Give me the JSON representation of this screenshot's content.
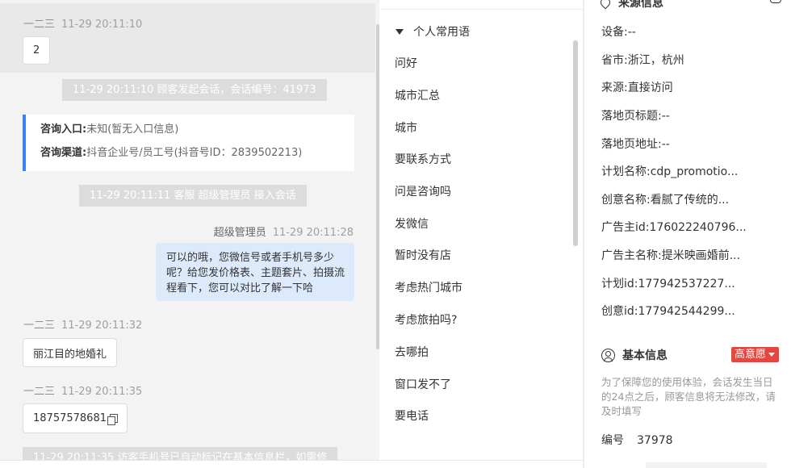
{
  "chat": {
    "messages": [
      {
        "sender": "一二三",
        "time": "11-29 20:11:10",
        "text": "2"
      },
      {
        "sender": "一二三",
        "time": "11-29 20:11:32",
        "text": "丽江目的地婚礼"
      },
      {
        "sender": "一二三",
        "time": "11-29 20:11:35",
        "text": "18757578681"
      }
    ],
    "system_start": "11-29 20:11:10 顾客发起会话，会话编号：41973",
    "consult": {
      "entry_label": "咨询入口:",
      "entry_value": "未知(暂无入口信息)",
      "channel_label": "咨询渠道:",
      "channel_value": "抖音企业号/员工号(抖音号ID：2839502213)"
    },
    "system_agent": "11-29 20:11:11 客服 超级管理员 接入会话",
    "agent_reply": {
      "sender": "超级管理员",
      "time": "11-29 20:11:28",
      "text": "可以的哦，您微信号或者手机号多少呢？给您发价格表、主题套片、拍摄流程看下，您可以对比了解一下哈"
    },
    "system_partial": "11-29 20:11:35 访客手机号已自动标记在基本信息栏，如需修"
  },
  "phrases": {
    "header": "个人常用语",
    "items": [
      "问好",
      "城市汇总",
      "城市",
      "要联系方式",
      "问是咨询吗",
      "发微信",
      "暂时没有店",
      "考虑热门城市",
      "考虑旅拍吗?",
      "去哪拍",
      "窗口发不了",
      "要电话"
    ]
  },
  "source": {
    "title": "来源信息",
    "fields": [
      {
        "label": "设备:",
        "value": "--"
      },
      {
        "label": "省市:",
        "value": "浙江，杭州"
      },
      {
        "label": "来源:",
        "value": "直接访问"
      },
      {
        "label": "落地页标题:",
        "value": "--"
      },
      {
        "label": "落地页地址:",
        "value": "--"
      },
      {
        "label": "计划名称:",
        "value": "cdp_promotio..."
      },
      {
        "label": "创意名称:",
        "value": "看腻了传统的..."
      },
      {
        "label": "广告主id:",
        "value": "176022240796..."
      },
      {
        "label": "广告主名称:",
        "value": "提米映画婚前..."
      },
      {
        "label": "计划id:",
        "value": "177942537227..."
      },
      {
        "label": "创意id:",
        "value": "177942544299..."
      }
    ]
  },
  "basic": {
    "title": "基本信息",
    "intent_badge": "高意愿",
    "notice": "为了保障您的使用体验，会话发生当日的24点之后，顾客信息将无法修改，请及时填写",
    "id_label": "编号",
    "id_value": "37978"
  },
  "colors": {
    "accent_blue": "#3b82f6",
    "agent_bubble": "#ddeafc",
    "intent_red": "#e8453c"
  }
}
